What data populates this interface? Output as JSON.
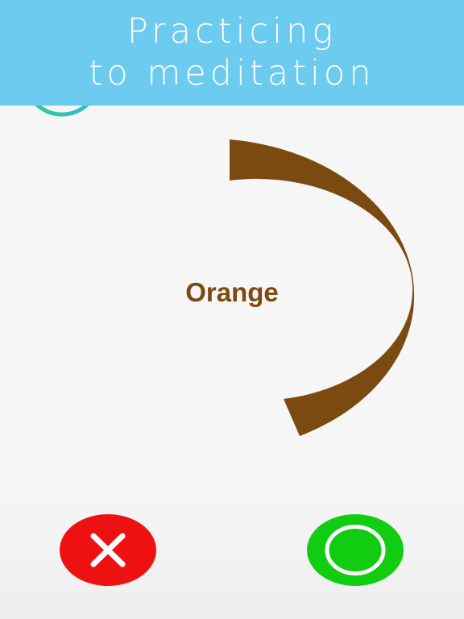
{
  "header": {
    "title_line1": "Practicing",
    "title_line2": "to meditation",
    "background_color": "#6ccbee"
  },
  "progress": {
    "icon": "progress-ring-icon",
    "colors": [
      "#3ab0e8",
      "#2ecc8a"
    ]
  },
  "stimulus": {
    "word": "Orange",
    "word_color": "#7b4a10",
    "arc_color": "#7b4a10"
  },
  "actions": {
    "no_button": {
      "icon": "close-icon",
      "color": "#ee1111"
    },
    "yes_button": {
      "icon": "circle-icon",
      "color": "#12cc12"
    }
  }
}
